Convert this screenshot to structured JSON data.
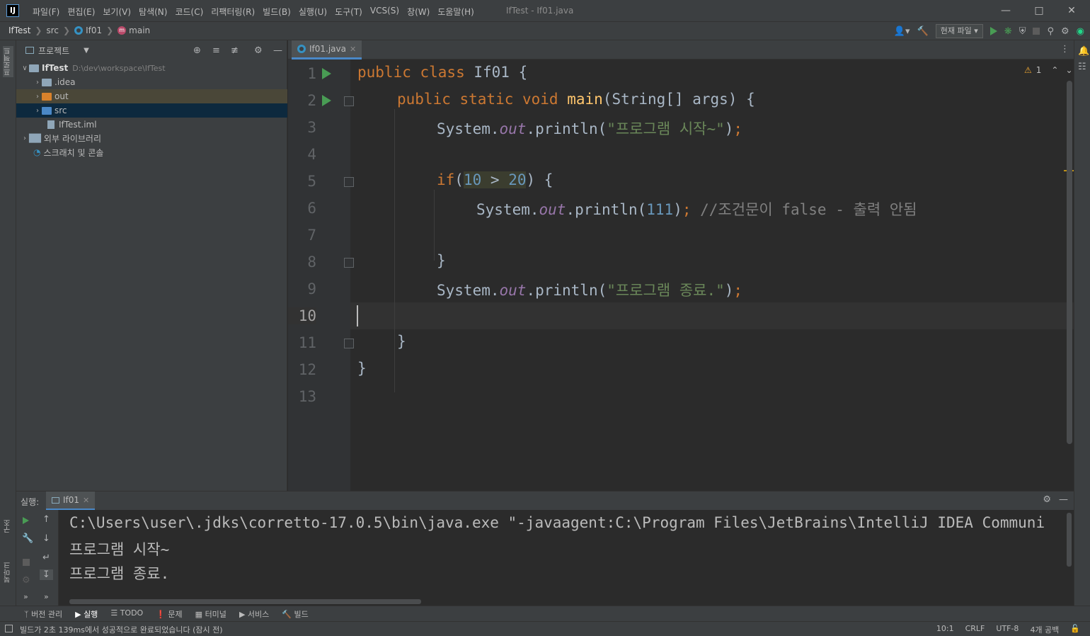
{
  "menubar": {
    "logo": "IJ",
    "menus": [
      "파일(F)",
      "편집(E)",
      "보기(V)",
      "탐색(N)",
      "코드(C)",
      "리팩터링(R)",
      "빌드(B)",
      "실행(U)",
      "도구(T)",
      "VCS(S)",
      "창(W)",
      "도움말(H)"
    ],
    "window_title": "IfTest - If01.java"
  },
  "navbar": {
    "project": "IfTest",
    "src": "src",
    "file": "If01",
    "method": "main",
    "run_config": "현재 파일"
  },
  "left_strip": {
    "project_label": "프로젝트",
    "structure_label": "구조",
    "bookmarks_label": "북마크"
  },
  "project_panel": {
    "title": "프로젝트",
    "root_name": "IfTest",
    "root_path": "D:\\dev\\workspace\\IfTest",
    "items": [
      ".idea",
      "out",
      "src",
      "IfTest.iml"
    ],
    "external_libs": "외부 라이브러리",
    "scratches": "스크래치 및 콘솔"
  },
  "editor": {
    "tab_label": "If01.java",
    "warning_count": "1",
    "line_numbers": [
      "1",
      "2",
      "3",
      "4",
      "5",
      "6",
      "7",
      "8",
      "9",
      "10",
      "11",
      "12",
      "13"
    ]
  },
  "code": {
    "l1": {
      "kw": "public class ",
      "name": "If01",
      "rest": " {"
    },
    "l2": {
      "kw": "public static void ",
      "fn": "main",
      "rest": "(String[] args) {"
    },
    "l3": {
      "a": "System.",
      "fld": "out",
      "b": ".println(",
      "str": "\"프로그램 시작~\"",
      "c": ")",
      "semi": ";"
    },
    "l5": {
      "kw": "if",
      "open": "(",
      "num1": "10",
      "op": " > ",
      "num2": "20",
      "rest": ") {"
    },
    "l6": {
      "a": "System.",
      "fld": "out",
      "b": ".println(",
      "num": "111",
      "c": ")",
      "semi": ";",
      "cmt": " //조건문이 false - 출력 안됨"
    },
    "l8": "}",
    "l9": {
      "a": "System.",
      "fld": "out",
      "b": ".println(",
      "str": "\"프로그램 종료.\"",
      "c": ")",
      "semi": ";"
    },
    "l11": "}",
    "l12": "}"
  },
  "run_panel": {
    "label": "실행:",
    "tab": "If01",
    "console_lines": [
      "C:\\Users\\user\\.jdks\\corretto-17.0.5\\bin\\java.exe \"-javaagent:C:\\Program Files\\JetBrains\\IntelliJ IDEA Communi",
      "프로그램 시작~",
      "프로그램 종료."
    ]
  },
  "tool_tabs": [
    "버전 관리",
    "실행",
    "TODO",
    "문제",
    "터미널",
    "서비스",
    "빌드"
  ],
  "status": {
    "message": "빌드가 2초 139ms에서 성공적으로 완료되었습니다 (잠시 전)",
    "position": "10:1",
    "line_sep": "CRLF",
    "encoding": "UTF-8",
    "indent": "4개 공백"
  },
  "colors": {
    "accent": "#4a88c7",
    "run_green": "#499c54",
    "keyword": "#cc7832",
    "string": "#6a8759"
  }
}
